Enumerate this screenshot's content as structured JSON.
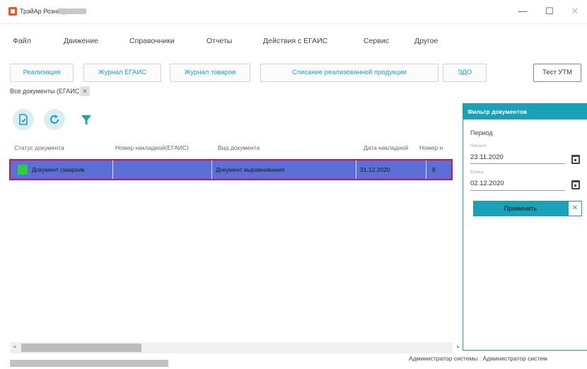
{
  "window": {
    "title": "ТрэйАр Розница",
    "minimize_glyph": "—",
    "maximize_glyph": "☐",
    "close_glyph": "✕"
  },
  "menu": {
    "items": [
      "Файл",
      "Движение",
      "Справочники",
      "Отчеты",
      "Действия с ЕГАИС",
      "Сервис",
      "Другое"
    ]
  },
  "tabs": {
    "items": [
      "Реализация",
      "Журнал ЕГАИС",
      "Журнал товаров",
      "Списание реализованной продукции",
      "ЭДО"
    ],
    "utm_button": "Тест УТМ"
  },
  "doc_tab": {
    "label": "Все документы (ЕГАИС)",
    "close_glyph": "✕"
  },
  "toolbar": {
    "icons": [
      "document-icon",
      "refresh-icon",
      "filter-icon"
    ]
  },
  "grid": {
    "columns": [
      "Статус документа",
      "Номер накладной(ЕГАИС)",
      "Вид документа",
      "Дата накладной",
      "Номер н"
    ],
    "rows": [
      {
        "status": "Документ (заархив",
        "number": "",
        "kind": "Документ выравнивания",
        "date": "31.12.2020",
        "num2": "8"
      }
    ],
    "selected_color": "#5b6fd6",
    "status_color": "#2ecc40"
  },
  "filter_panel": {
    "title": "Фильтр документов",
    "period_label": "Период",
    "from_label": "Начало",
    "from_value": "23.11.2020",
    "to_label": "Конец",
    "to_value": "02.12.2020",
    "apply_label": "Применить",
    "clear_glyph": "✕",
    "accent": "#1aa1b8"
  },
  "status_bar": {
    "user": "Администратор системы : Администратор систем"
  }
}
